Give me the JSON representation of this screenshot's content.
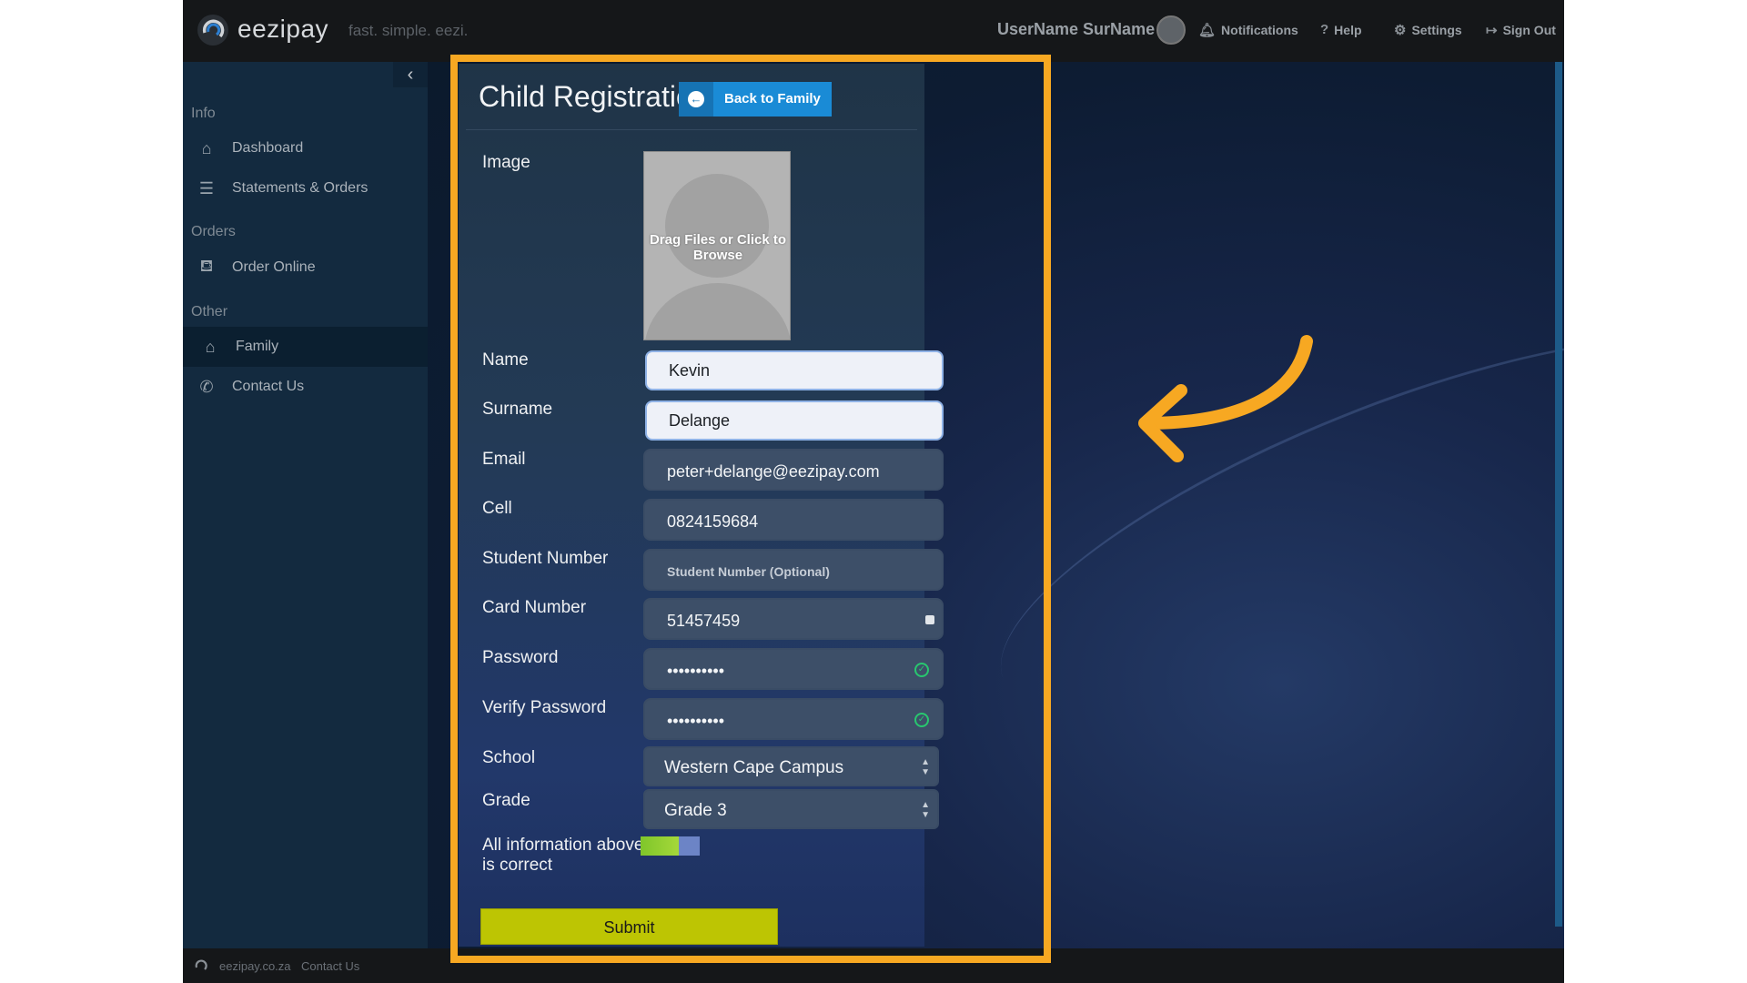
{
  "app": {
    "brand": "eezipay",
    "tagline": "fast. simple. eezi.",
    "colors": {
      "accent": "#1a8bd6",
      "highlight": "#f7a822",
      "submit": "#bdc503",
      "toggle_on": "#7fc62a"
    }
  },
  "topbar": {
    "username": "UserName SurName",
    "notifications": "Notifications",
    "help": "Help",
    "settings": "Settings",
    "sign_out": "Sign Out"
  },
  "sidebar": {
    "collapse_icon": "chevron-left-icon",
    "sections": [
      {
        "label": "Info",
        "items": [
          {
            "label": "Dashboard",
            "icon": "home-icon"
          },
          {
            "label": "Statements & Orders",
            "icon": "list-icon"
          }
        ]
      },
      {
        "label": "Orders",
        "items": [
          {
            "label": "Order Online",
            "icon": "basket-icon"
          }
        ]
      },
      {
        "label": "Other",
        "items": [
          {
            "label": "Family",
            "icon": "family-icon",
            "active": true
          },
          {
            "label": "Contact Us",
            "icon": "phone-icon"
          }
        ]
      }
    ]
  },
  "form": {
    "title": "Child Registration",
    "back_button": "Back to Family",
    "image_label": "Image",
    "image_dropzone": "Drag Files or Click to Browse",
    "fields": {
      "name": {
        "label": "Name",
        "value": "Kevin"
      },
      "surname": {
        "label": "Surname",
        "value": "Delange"
      },
      "email": {
        "label": "Email",
        "value": "peter+delange@eezipay.com"
      },
      "cell": {
        "label": "Cell",
        "value": "0824159684"
      },
      "student_number": {
        "label": "Student Number",
        "placeholder": "Student Number (Optional)"
      },
      "card_number": {
        "label": "Card Number",
        "value": "51457459"
      },
      "password": {
        "label": "Password",
        "value": "••••••••••"
      },
      "verify_password": {
        "label": "Verify Password",
        "value": "••••••••••"
      },
      "school": {
        "label": "School",
        "value": "Western Cape Campus"
      },
      "grade": {
        "label": "Grade",
        "value": "Grade 3"
      }
    },
    "confirm_label": "All information above is correct",
    "confirm_toggle": true,
    "submit": "Submit"
  },
  "footer": {
    "site": "eezipay.co.za",
    "contact": "Contact Us"
  }
}
